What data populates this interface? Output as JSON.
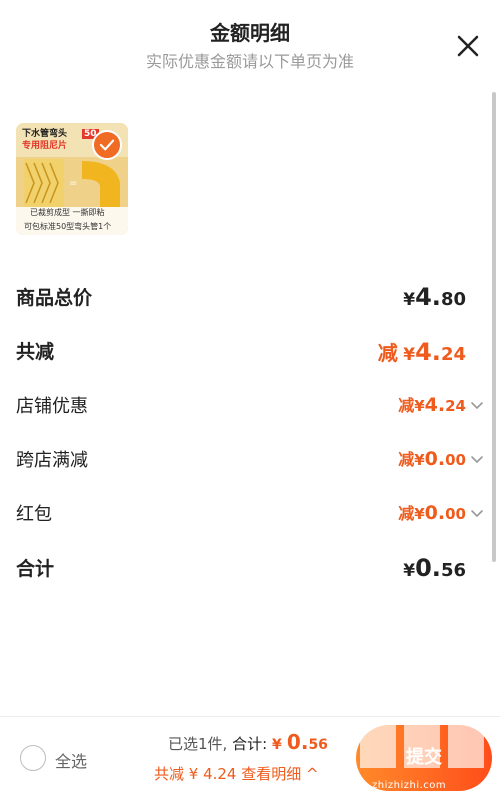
{
  "header": {
    "title": "金额明细",
    "subtitle": "实际优惠金额请以下单页为准"
  },
  "product": {
    "badge_top": "下水管弯头",
    "badge_sub": "专用阻尼片",
    "badge_num": "50",
    "caption_main": "已裁剪成型 一撕即粘",
    "caption_sub": "可包标准50型弯头管1个",
    "selected": true
  },
  "rows": {
    "total_price": {
      "label": "商品总价",
      "symbol": "¥",
      "int": "4.",
      "dec": "80"
    },
    "total_discount": {
      "label": "共减",
      "prefix": "减",
      "symbol": "¥",
      "int": "4.",
      "dec": "24"
    },
    "shop_discount": {
      "label": "店铺优惠",
      "prefix": "减",
      "symbol": "¥",
      "int": "4.",
      "dec": "24"
    },
    "cross_shop": {
      "label": "跨店满减",
      "prefix": "减",
      "symbol": "¥",
      "int": "0.",
      "dec": "00"
    },
    "red_packet": {
      "label": "红包",
      "prefix": "减",
      "symbol": "¥",
      "int": "0.",
      "dec": "00"
    },
    "sum": {
      "label": "合计",
      "symbol": "¥",
      "int": "0.",
      "dec": "56"
    }
  },
  "footer": {
    "select_all": "全选",
    "selected_count": "已选1件,",
    "total_label": "合计:",
    "total_symbol": "¥",
    "total_int": "0.",
    "total_dec": "56",
    "discount_text": "共减 ¥ 4.24",
    "detail_link": "查看明细 ^",
    "submit_label": "提交"
  },
  "watermark": {
    "site": "zhizhizhi.com"
  },
  "colors": {
    "accent": "#ef5b1d",
    "text": "#222222",
    "muted": "#9a9a9a"
  },
  "icons": {
    "close": "close-icon",
    "check": "check-icon",
    "chevron": "chevron-down-icon"
  }
}
